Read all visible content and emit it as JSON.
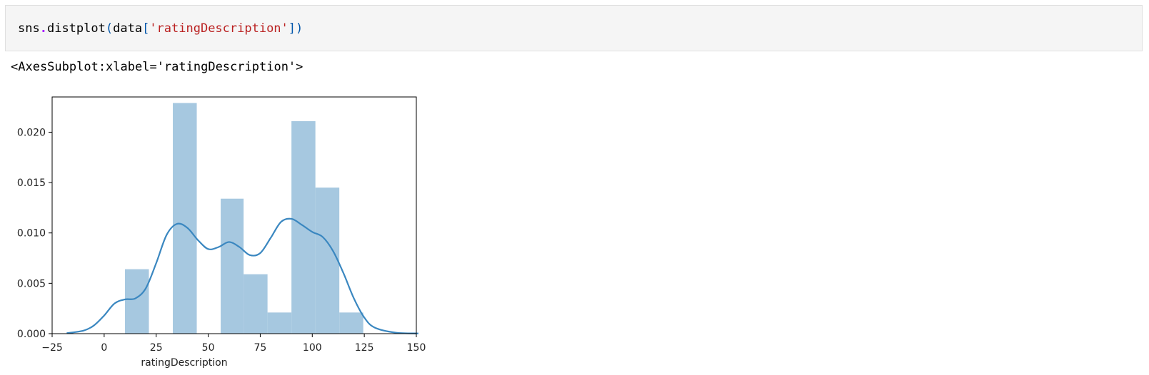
{
  "code_cell": {
    "code_fn": "sns",
    "code_dot": ".",
    "code_method": "distplot",
    "code_open": "(",
    "code_arg": "data",
    "code_bracket_open": "[",
    "code_str": "'ratingDescription'",
    "code_bracket_close": "]",
    "code_close": ")"
  },
  "output": {
    "repr": "<AxesSubplot:xlabel='ratingDescription'>"
  },
  "colors": {
    "hist_fill": "#a6c8e0",
    "kde_line": "#3a87c0",
    "axis": "#000000"
  },
  "chart_data": {
    "type": "bar",
    "xlabel": "ratingDescription",
    "ylabel": "",
    "xlim": [
      -25,
      150
    ],
    "ylim": [
      0,
      0.0235
    ],
    "x_ticks": [
      "−25",
      "0",
      "25",
      "50",
      "75",
      "100",
      "125",
      "150"
    ],
    "x_tick_values": [
      -25,
      0,
      25,
      50,
      75,
      100,
      125,
      150
    ],
    "y_ticks": [
      "0.000",
      "0.005",
      "0.010",
      "0.015",
      "0.020"
    ],
    "y_tick_values": [
      0,
      0.005,
      0.01,
      0.015,
      0.02
    ],
    "histogram": [
      {
        "x0": 10,
        "x1": 21.5,
        "density": 0.0064
      },
      {
        "x0": 21.5,
        "x1": 33,
        "density": 0.0
      },
      {
        "x0": 33,
        "x1": 44.5,
        "density": 0.0229
      },
      {
        "x0": 44.5,
        "x1": 56,
        "density": 0.0
      },
      {
        "x0": 56,
        "x1": 67,
        "density": 0.0134
      },
      {
        "x0": 67,
        "x1": 78.5,
        "density": 0.0059
      },
      {
        "x0": 78.5,
        "x1": 90,
        "density": 0.0021
      },
      {
        "x0": 90,
        "x1": 101.5,
        "density": 0.0211
      },
      {
        "x0": 101.5,
        "x1": 113,
        "density": 0.0145
      },
      {
        "x0": 113,
        "x1": 124.5,
        "density": 0.0021
      }
    ],
    "kde": {
      "x": [
        -18,
        -10,
        -5,
        0,
        5,
        10,
        15,
        20,
        25,
        30,
        35,
        40,
        45,
        50,
        55,
        60,
        65,
        70,
        75,
        80,
        85,
        90,
        95,
        100,
        105,
        110,
        115,
        120,
        125,
        130,
        140,
        151
      ],
      "y": [
        5e-05,
        0.0003,
        0.0008,
        0.0018,
        0.003,
        0.0034,
        0.0035,
        0.0045,
        0.007,
        0.0098,
        0.0109,
        0.0105,
        0.0093,
        0.0084,
        0.0086,
        0.0091,
        0.0086,
        0.0078,
        0.008,
        0.0095,
        0.0111,
        0.0114,
        0.0108,
        0.0101,
        0.0096,
        0.0082,
        0.006,
        0.0035,
        0.0016,
        0.0006,
        0.0001,
        2e-05
      ]
    }
  }
}
